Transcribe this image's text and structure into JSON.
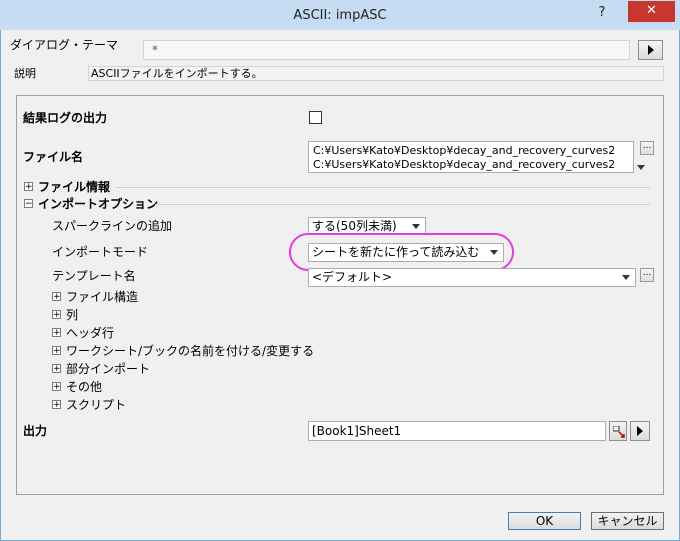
{
  "window": {
    "title": "ASCII: impASC",
    "help": "?",
    "close": "✕"
  },
  "theme": {
    "label": "ダイアログ・テーマ",
    "value": "*"
  },
  "description": {
    "label": "説明",
    "value": "ASCIIファイルをインポートする。"
  },
  "result_log": {
    "label": "結果ログの出力",
    "checked": false
  },
  "file_name": {
    "label": "ファイル名",
    "lines": [
      "C:¥Users¥Kato¥Desktop¥decay_and_recovery_curves2",
      "C:¥Users¥Kato¥Desktop¥decay_and_recovery_curves2"
    ],
    "browse": "..."
  },
  "file_info": {
    "label": "ファイル情報"
  },
  "import_options": {
    "label": "インポートオプション",
    "sparkline": {
      "label": "スパークラインの追加",
      "value": "する(50列未満)"
    },
    "import_mode": {
      "label": "インポートモード",
      "value": "シートを新たに作って読み込む"
    },
    "template": {
      "label": "テンプレート名",
      "value": "<デフォルト>",
      "browse": "..."
    },
    "sections": [
      {
        "label": "ファイル構造"
      },
      {
        "label": "列"
      },
      {
        "label": "ヘッダ行"
      },
      {
        "label": "ワークシート/ブックの名前を付ける/変更する"
      },
      {
        "label": "部分インポート"
      },
      {
        "label": "その他"
      },
      {
        "label": "スクリプト"
      }
    ]
  },
  "output": {
    "label": "出力",
    "value": "[Book1]Sheet1"
  },
  "buttons": {
    "ok": "OK",
    "cancel": "キャンセル"
  },
  "glyphs": {
    "plus": "+",
    "minus": "−"
  }
}
